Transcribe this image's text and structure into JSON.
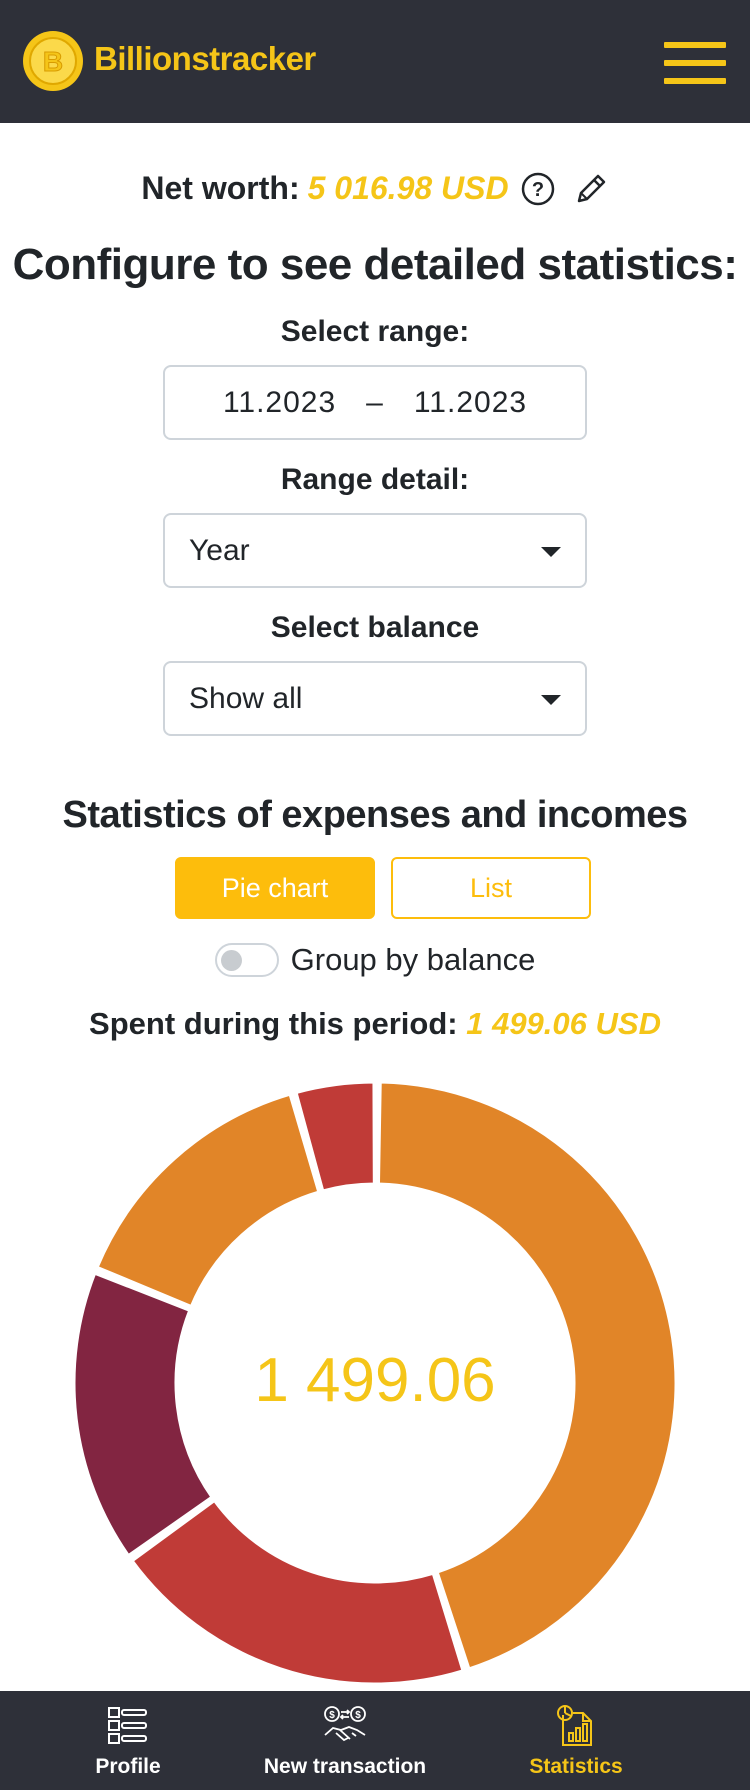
{
  "header": {
    "brand": "Billionstracker",
    "logo_letter": "B",
    "menu_icon": "hamburger-menu-icon"
  },
  "networth": {
    "label": "Net worth:",
    "value": "5 016.98 USD",
    "help_icon": "question-circle-icon",
    "edit_icon": "pencil-icon"
  },
  "config": {
    "title": "Configure to see detailed statistics:",
    "range_label": "Select range:",
    "range_start": "11.2023",
    "range_separator": "–",
    "range_end": "11.2023",
    "detail_label": "Range detail:",
    "detail_value": "Year",
    "balance_label": "Select balance",
    "balance_value": "Show all"
  },
  "stats": {
    "title": "Statistics of expenses and incomes",
    "pie_button": "Pie chart",
    "list_button": "List",
    "group_toggle_label": "Group by balance",
    "group_toggle_on": false,
    "spent_label": "Spent during this period:",
    "spent_value": "1 499.06 USD",
    "center_total": "1 499.06"
  },
  "chart_data": {
    "type": "pie",
    "total": 1499.06,
    "segments": [
      {
        "color": "#e18528",
        "fraction": 0.145
      },
      {
        "color": "#c03b37",
        "fraction": 0.045
      },
      {
        "color": "#e18528",
        "fraction": 0.45
      },
      {
        "color": "#c03b37",
        "fraction": 0.2
      },
      {
        "color": "#822541",
        "fraction": 0.16
      }
    ]
  },
  "bottom_nav": [
    {
      "label": "Profile",
      "icon": "list-icon",
      "active": false
    },
    {
      "label": "New transaction",
      "icon": "handshake-exchange-icon",
      "active": false
    },
    {
      "label": "Statistics",
      "icon": "report-chart-icon",
      "active": true
    }
  ],
  "colors": {
    "accent": "#f5c518",
    "button": "#fdbd0c",
    "bar": "#2e3039"
  }
}
